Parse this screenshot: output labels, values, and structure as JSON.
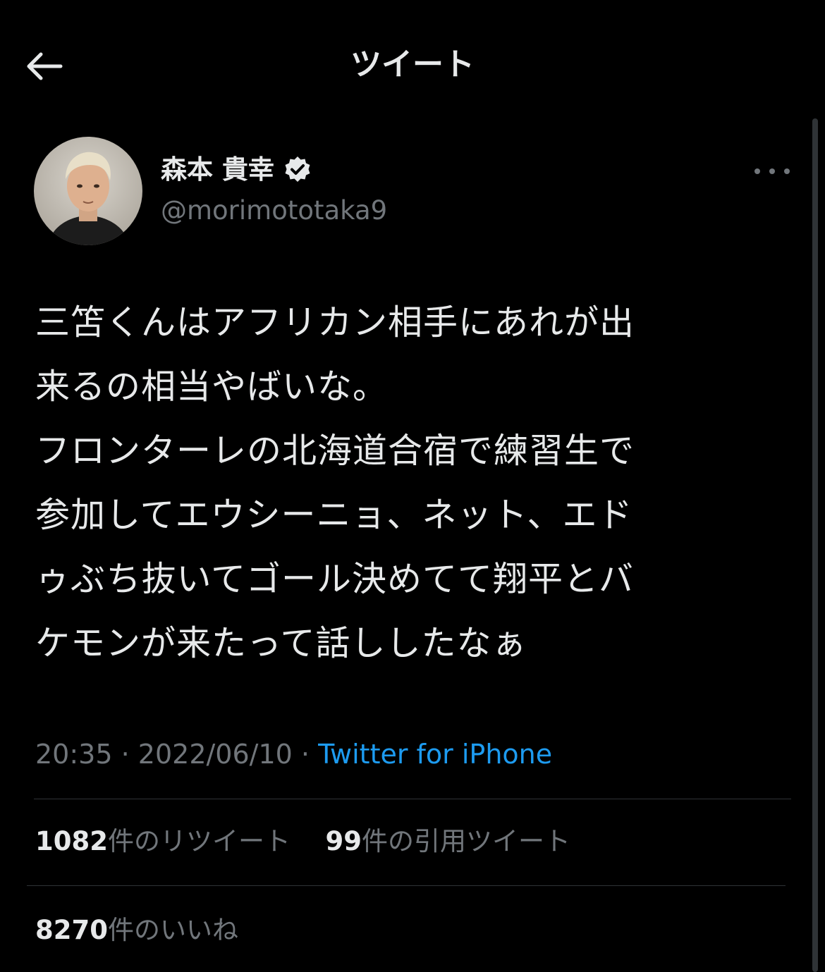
{
  "header": {
    "title": "ツイート",
    "back_icon": "arrow-left-icon"
  },
  "tweet": {
    "author_name": "森本 貴幸",
    "verified_icon": "verified-badge-icon",
    "handle": "@morimototaka9",
    "more_icon": "more-horizontal-icon",
    "text": "三笘くんはアフリカン相手にあれが出\n来るの相当やばいな。\nフロンターレの北海道合宿で練習生で\n参加してエウシーニョ、ネット、エド\nゥぶち抜いてゴール決めてて翔平とバ\nケモンが来たって話ししたなぁ",
    "time": "20:35",
    "separator": "·",
    "date": "2022/06/10",
    "source": "Twitter for iPhone"
  },
  "stats": {
    "retweets_count": "1082",
    "retweets_label": "件のリツイート",
    "quotes_count": "99",
    "quotes_label": "件の引用ツイート",
    "likes_count": "8270",
    "likes_label": "件のいいね"
  },
  "colors": {
    "background": "#000000",
    "text": "#e7e9ea",
    "secondary": "#71767b",
    "link": "#1d9bf0",
    "divider": "#2f3336"
  }
}
